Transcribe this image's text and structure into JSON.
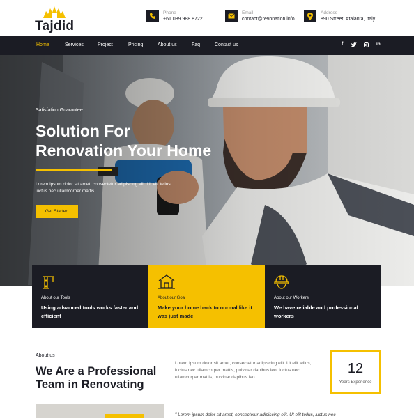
{
  "brand": {
    "name": "Tajdid"
  },
  "contacts": [
    {
      "label": "Phone",
      "value": "+61 089 988 8722",
      "icon": "phone-icon"
    },
    {
      "label": "Email",
      "value": "contact@revonation.info",
      "icon": "envelope-icon"
    },
    {
      "label": "Address",
      "value": "890 Street, Atalanta, Italy",
      "icon": "map-pin-icon"
    }
  ],
  "nav": {
    "items": [
      "Home",
      "Services",
      "Project",
      "Pricing",
      "About us",
      "Faq",
      "Contact us"
    ],
    "active": "Home",
    "social": [
      "facebook-icon",
      "twitter-icon",
      "instagram-icon",
      "linkedin-icon"
    ]
  },
  "hero": {
    "eyebrow": "Satisfation Guarantee",
    "title_line1": "Solution For",
    "title_line2": "Renovation Your Home",
    "text": "Lorem ipsum dolor sit amet, consectetur adipiscing elit. Ut elit tellus, luctus nec ullamcorper mattis",
    "cta": "Get Started"
  },
  "features": [
    {
      "label": "About our Tools",
      "title": "Using advanced tools works faster and efficient",
      "icon": "crane-icon"
    },
    {
      "label": "About our Goal",
      "title": "Make your home back to normal like it was just made",
      "icon": "house-icon"
    },
    {
      "label": "About our Workers",
      "title": "We have reliable and professional workers",
      "icon": "helmet-icon"
    }
  ],
  "about": {
    "label": "About us",
    "title": "We Are a Professional Team in Renovating",
    "text": "Lorem ipsum dolor sit amet, consectetur adipiscing elit. Ut elit tellus, luctus nec ullamcorper mattis, pulvinar dapibus leo. luctus nec ullamcorper mattis, pulvinar dapibus leo.",
    "experience_number": "12",
    "experience_label": "Years Experience",
    "quote": "\" Lorem ipsum dolor sit amet, consectetur adipiscing elit. Ut elit tellus, luctus nec"
  },
  "colors": {
    "accent": "#f5c000",
    "dark": "#1b1c24"
  }
}
